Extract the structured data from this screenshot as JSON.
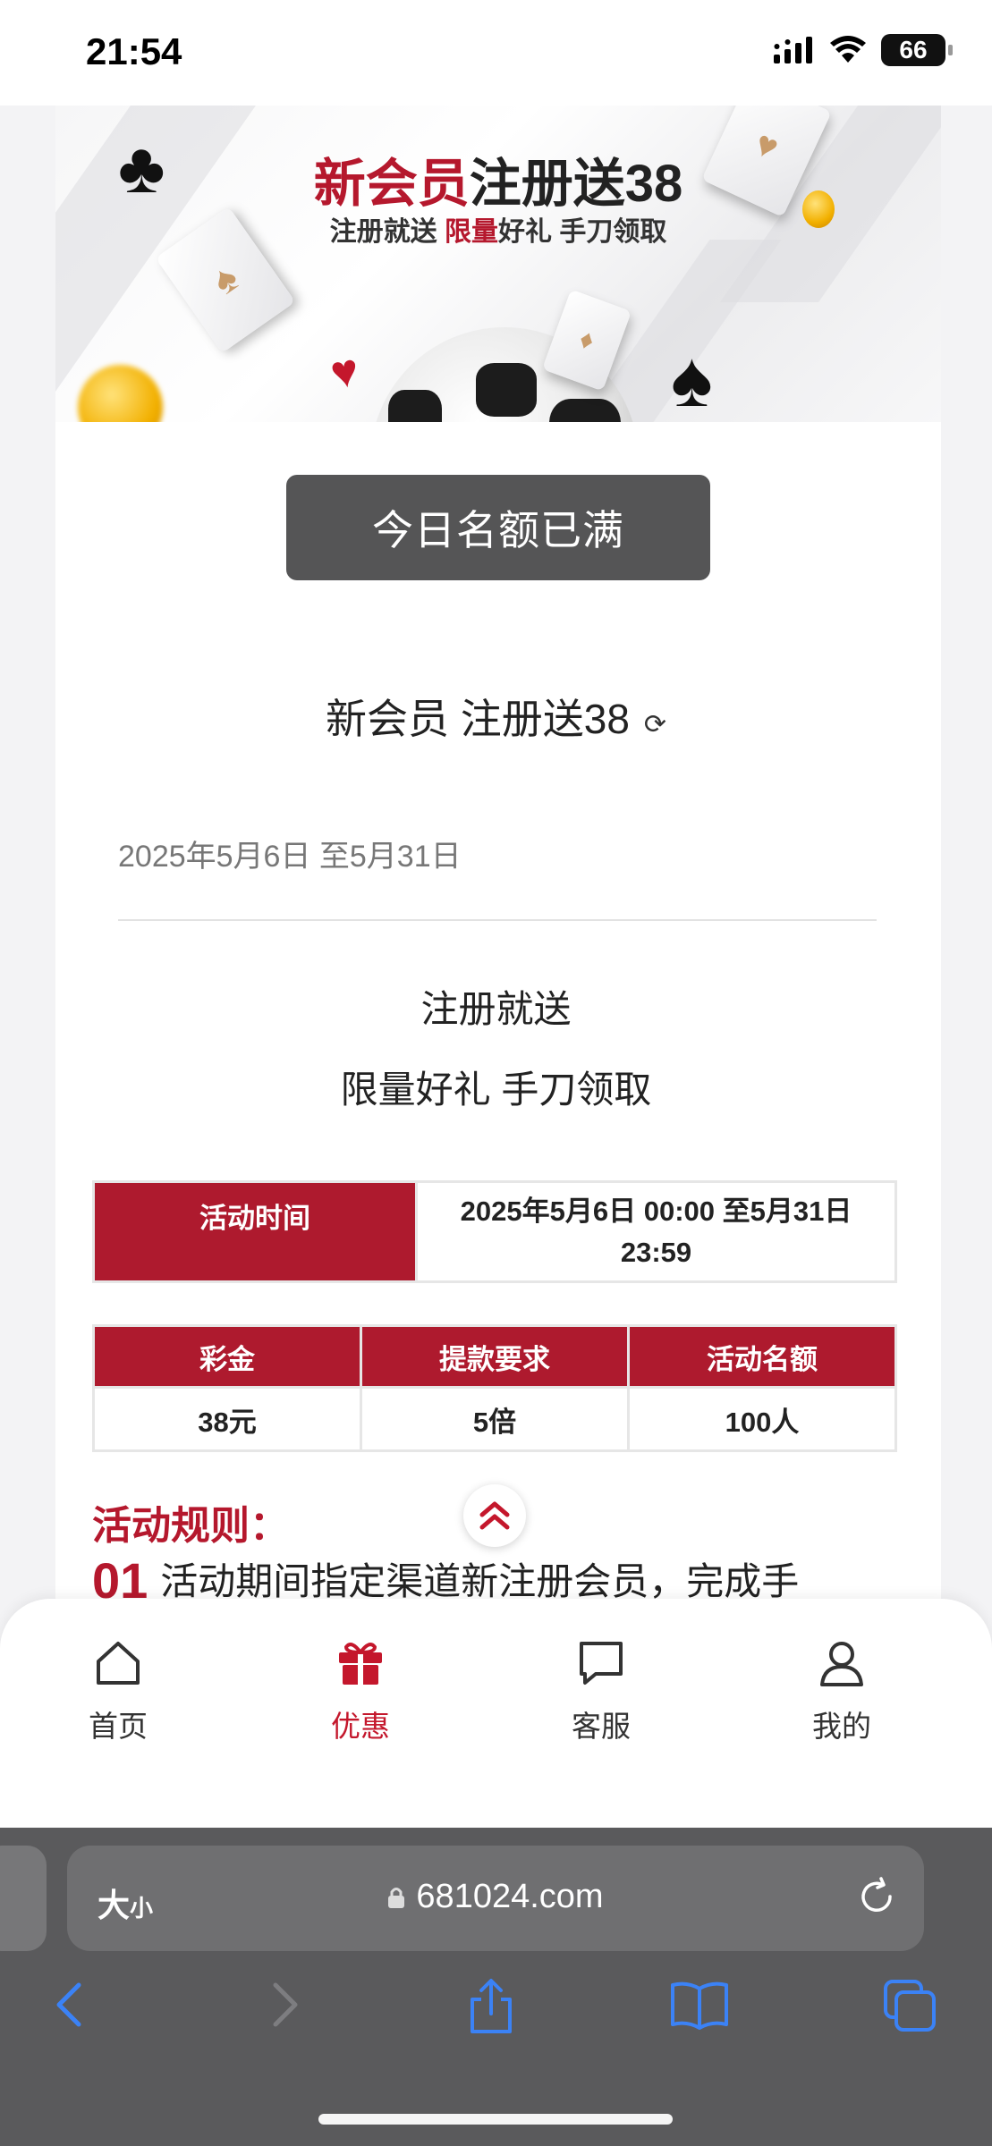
{
  "status_bar": {
    "time": "21:54",
    "battery": "66"
  },
  "banner": {
    "title_part1": "新会员",
    "title_part2": "注册送38",
    "sub_part1": "注册就送 ",
    "sub_highlight": "限量",
    "sub_part2": "好礼 手刀领取"
  },
  "action_button": {
    "label": "今日名额已满"
  },
  "promo": {
    "title": "新会员 注册送38",
    "date_range": "2025年5月6日 至5月31日",
    "desc_line1": "注册就送",
    "desc_line2": "限量好礼 手刀领取"
  },
  "activity_time": {
    "label": "活动时间",
    "value_line1": "2025年5月6日 00:00 至5月31日",
    "value_line2": "23:59"
  },
  "bonus_table": {
    "headers": [
      "彩金",
      "提款要求",
      "活动名额"
    ],
    "values": [
      "38元",
      "5倍",
      "100人"
    ]
  },
  "rules": {
    "title": "活动规则：",
    "items": [
      {
        "num": "01",
        "text": "活动期间指定渠道新注册会员，完成手"
      }
    ]
  },
  "tabbar": {
    "items": [
      {
        "label": "首页",
        "icon": "home-icon"
      },
      {
        "label": "优惠",
        "icon": "gift-icon",
        "active": true
      },
      {
        "label": "客服",
        "icon": "chat-icon"
      },
      {
        "label": "我的",
        "icon": "user-icon"
      }
    ]
  },
  "browser": {
    "text_size_big": "大",
    "text_size_small": "小",
    "url": "681024.com"
  },
  "colors": {
    "accent": "#b5182d",
    "button_gray": "#555556",
    "safari_bg": "#5a5a5c",
    "ios_blue": "#3b82f6"
  }
}
